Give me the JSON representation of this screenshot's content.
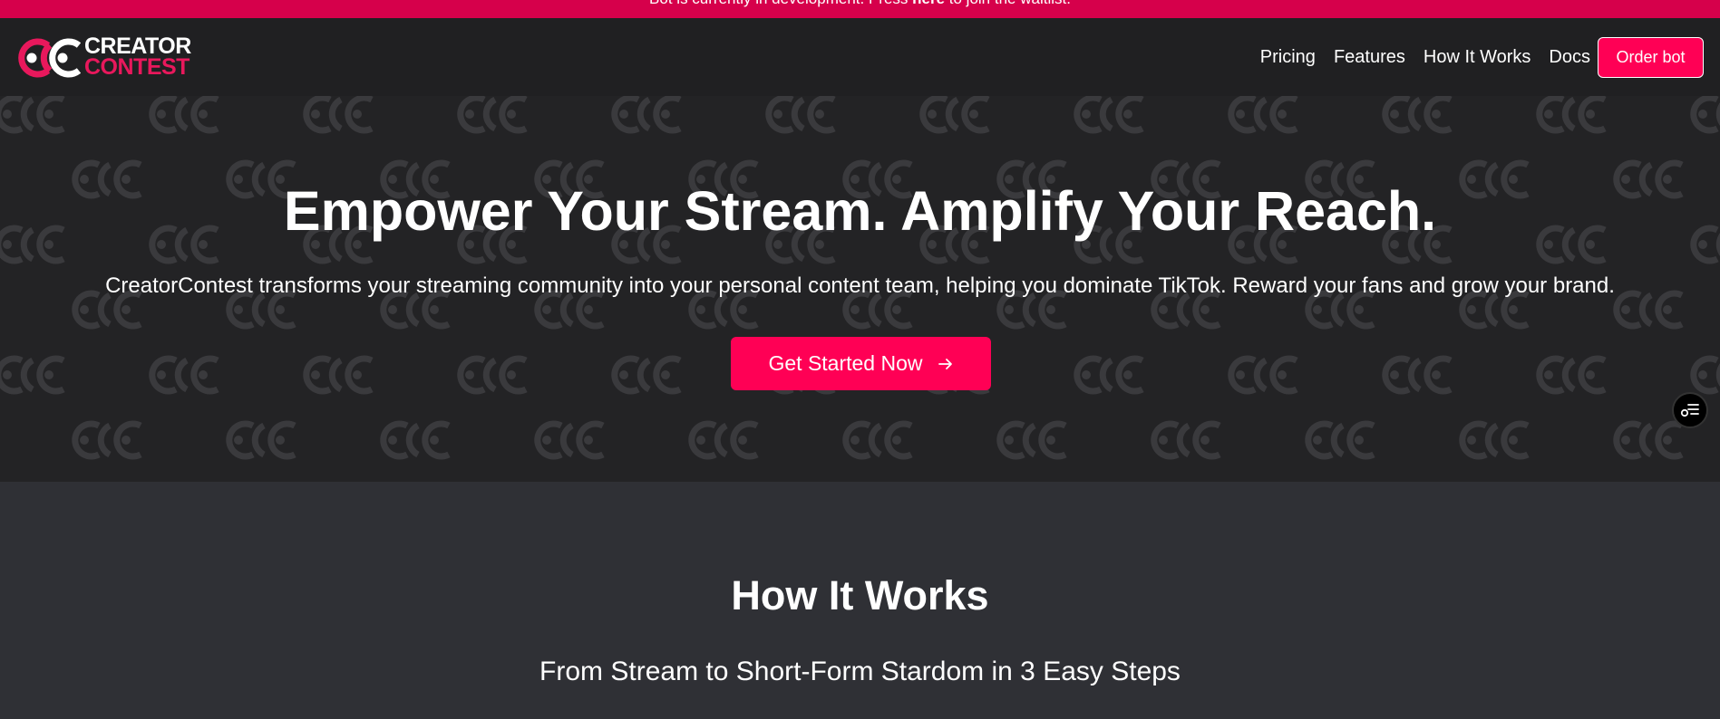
{
  "banner": {
    "text_before": "Bot is currently in development. Press ",
    "link": "here",
    "text_after": " to join the waitlist."
  },
  "nav": {
    "logo": {
      "line1": "CREATOR",
      "line2": "CONTEST",
      "icon": "creatorcontest-logo-icon"
    },
    "links": [
      "Pricing",
      "Features",
      "How It Works",
      "Docs"
    ],
    "order_button": "Order bot"
  },
  "hero": {
    "title": "Empower Your Stream. Amplify Your Reach.",
    "subtitle": "CreatorContest transforms your streaming community into your personal content team, helping you dominate TikTok. Reward your fans and grow your brand.",
    "cta": "Get Started Now",
    "cta_icon": "arrow-right-icon"
  },
  "fab": {
    "icon": "list-settings-icon"
  },
  "how_it_works": {
    "title": "How It Works",
    "subtitle": "From Stream to Short-Form Stardom in 3 Easy Steps"
  },
  "colors": {
    "accent": "#ff0055",
    "banner": "#d6004b",
    "nav_bg": "#202022",
    "hero_bg": "#232325",
    "section_bg": "#2f3035",
    "pattern": "#3a3a3d"
  }
}
